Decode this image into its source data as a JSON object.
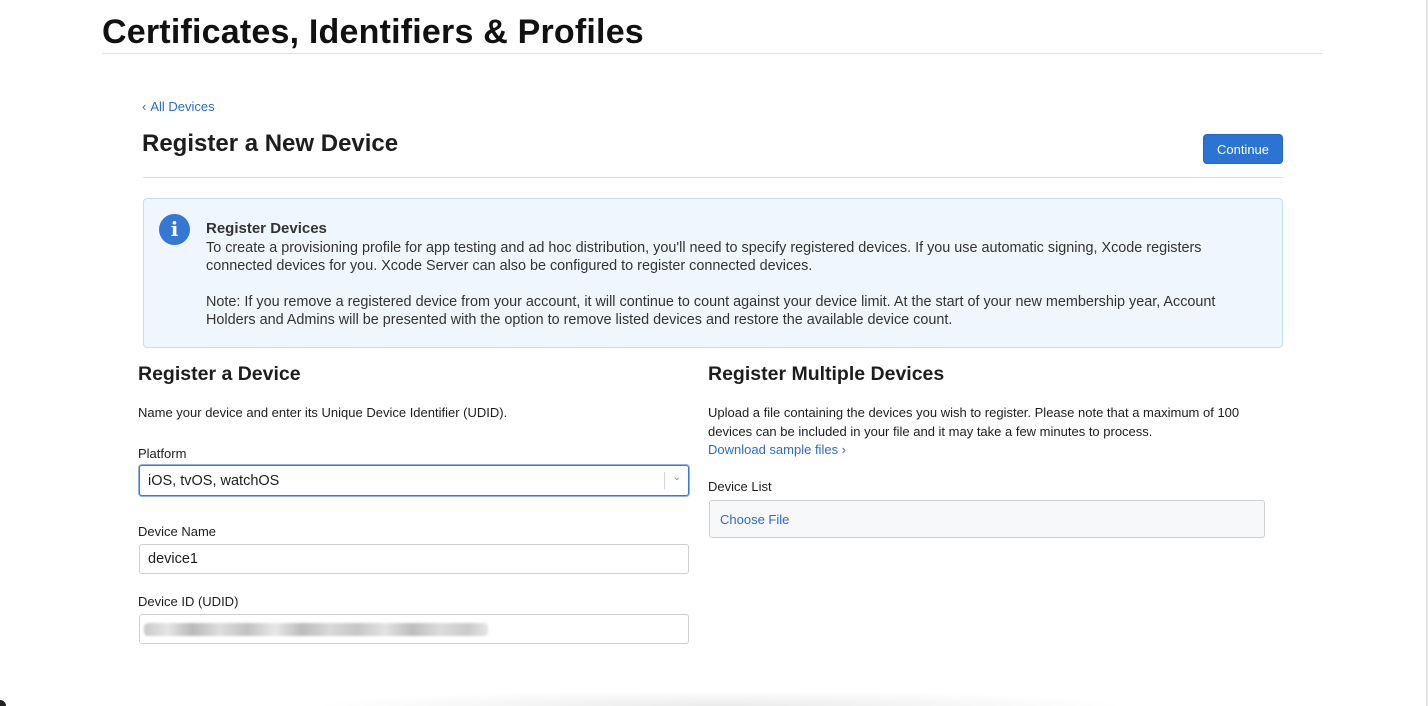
{
  "page": {
    "title": "Certificates, Identifiers & Profiles"
  },
  "nav": {
    "back_link": "All Devices",
    "back_chevron": "‹"
  },
  "section": {
    "title": "Register a New Device",
    "continue_label": "Continue"
  },
  "info": {
    "icon": "info-icon",
    "icon_glyph": "i",
    "title": "Register Devices",
    "paragraph1": "To create a provisioning profile for app testing and ad hoc distribution, you'll need to specify registered devices. If you use automatic signing, Xcode registers connected devices for you. Xcode Server can also be configured to register connected devices.",
    "paragraph2": "Note: If you remove a registered device from your account, it will continue to count against your device limit. At the start of your new membership year, Account Holders and Admins will be presented with the option to remove listed devices and restore the available device count."
  },
  "register_device": {
    "title": "Register a Device",
    "description": "Name your device and enter its Unique Device Identifier (UDID).",
    "platform_label": "Platform",
    "platform_value": "iOS, tvOS, watchOS",
    "device_name_label": "Device Name",
    "device_name_value": "device1",
    "device_id_label": "Device ID (UDID)"
  },
  "register_multiple": {
    "title": "Register Multiple Devices",
    "description": "Upload a file containing the devices you wish to register. Please note that a maximum of 100 devices can be included in your file and it may take a few minutes to process.",
    "sample_link": "Download sample files ›",
    "device_list_label": "Device List",
    "choose_file_label": "Choose File"
  },
  "colors": {
    "accent": "#2b74d1",
    "link": "#2a6bcc",
    "info_bg": "#eff6fd",
    "info_border": "#bfe0f0"
  }
}
